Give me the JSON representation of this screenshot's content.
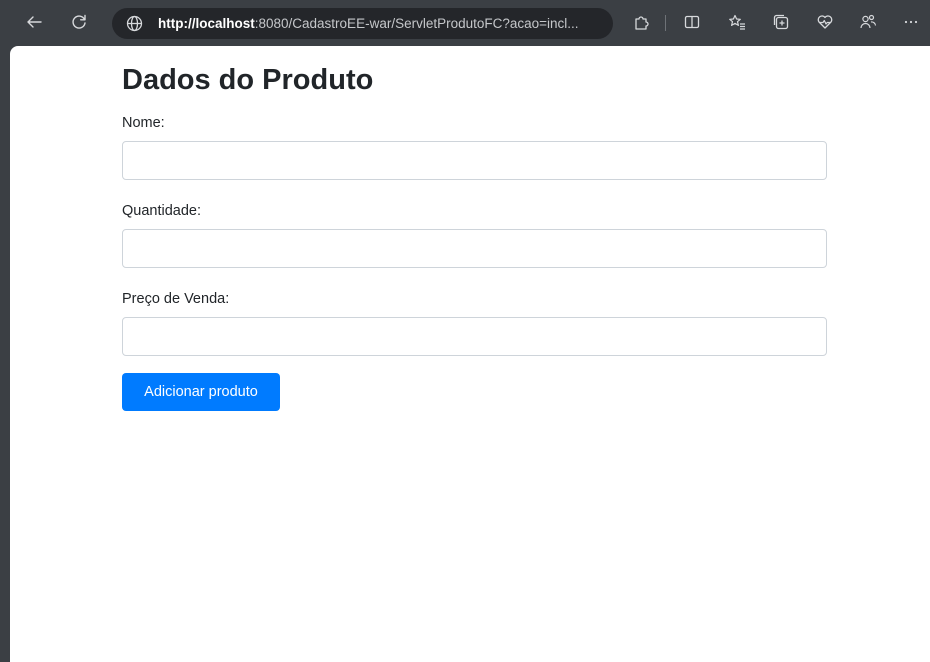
{
  "browser": {
    "url_host": "http://localhost",
    "url_rest": ":8080/CadastroEE-war/ServletProdutoFC?acao=incl..."
  },
  "page": {
    "title": "Dados do Produto",
    "fields": [
      {
        "label": "Nome:",
        "value": ""
      },
      {
        "label": "Quantidade:",
        "value": ""
      },
      {
        "label": "Preço de Venda:",
        "value": ""
      }
    ],
    "submit_label": "Adicionar produto"
  },
  "colors": {
    "primary": "#007bff",
    "toolbar": "#3b3f44",
    "address_bar": "#24262a"
  }
}
